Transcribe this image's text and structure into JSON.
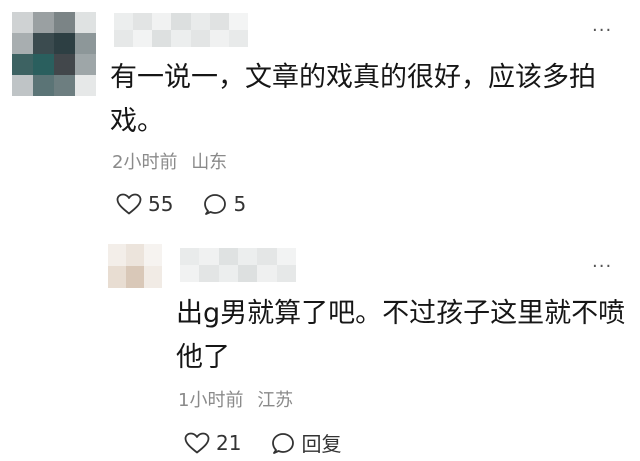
{
  "colors": {
    "text": "#161616",
    "meta": "#8a8a8a",
    "icon": "#333333"
  },
  "comment": {
    "avatar_icon": "user-avatar-icon",
    "text": "有一说一，文章的戏真的很好，应该多拍戏。",
    "time": "2小时前",
    "location": "山东",
    "likes": "55",
    "replies": "5",
    "more_icon": "more-dots-icon"
  },
  "reply": {
    "avatar_icon": "user-avatar-icon",
    "text": "出g男就算了吧。不过孩子这里就不喷他了",
    "time": "1小时前",
    "location": "江苏",
    "likes": "21",
    "reply_label": "回复",
    "more_icon": "more-dots-icon"
  }
}
